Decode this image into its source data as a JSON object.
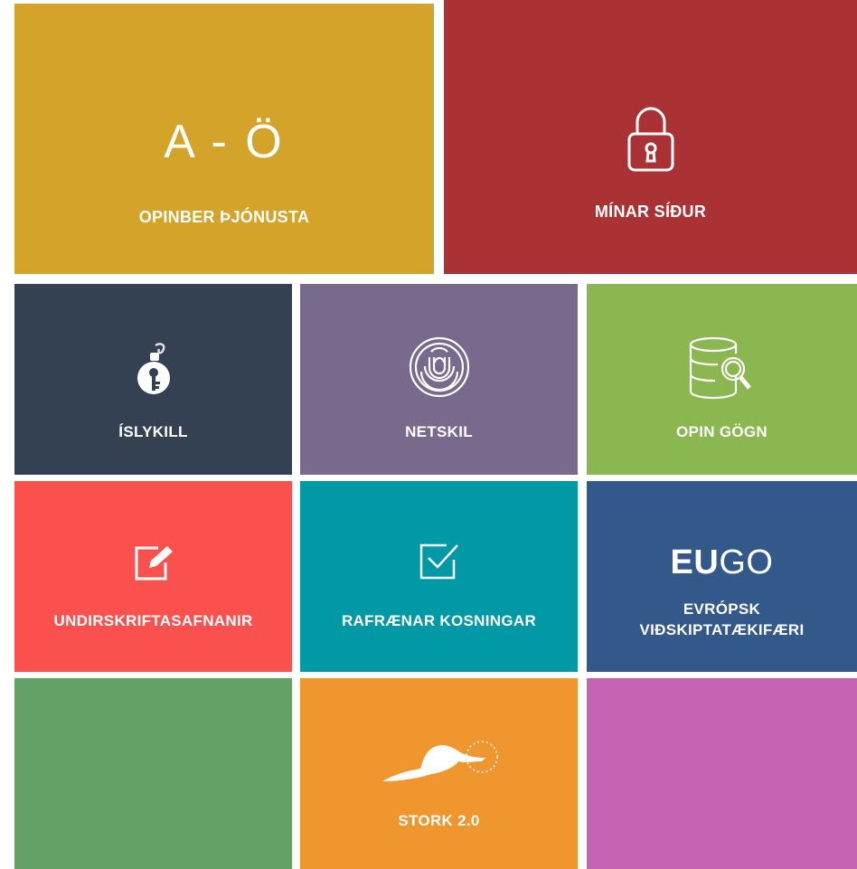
{
  "tiles": {
    "opinber": {
      "big_text": "A - Ö",
      "label": "OPINBER ÞJÓNUSTA",
      "color": "#d4a42a"
    },
    "minar": {
      "label": "MÍNAR SÍÐUR",
      "icon": "padlock-icon",
      "color": "#aa3235"
    },
    "islykill": {
      "label": "ÍSLYKILL",
      "icon": "key-bomb-icon",
      "color": "#334152"
    },
    "netskil": {
      "label": "NETSKIL",
      "icon": "fingerprint-icon",
      "color": "#776a8c"
    },
    "opingogn": {
      "label": "OPIN GÖGN",
      "icon": "database-search-icon",
      "color": "#8ab750"
    },
    "undirskrift": {
      "label": "UNDIRSKRIFTASAFNANIR",
      "icon": "edit-icon",
      "color": "#fa514f"
    },
    "rafraenar": {
      "label": "RAFRÆNAR KOSNINGAR",
      "icon": "checkbox-icon",
      "color": "#0199a6"
    },
    "eugo": {
      "logo_eu": "EU",
      "logo_go": "GO",
      "label_line1": "EVRÓPSK",
      "label_line2": "VIÐSKIPTATÆKIFÆRI",
      "color": "#32598a"
    },
    "green": {
      "color": "#63a167"
    },
    "stork": {
      "label": "STORK 2.0",
      "icon": "stork-icon",
      "color": "#ef962f"
    },
    "purple": {
      "color": "#c462b3"
    }
  }
}
